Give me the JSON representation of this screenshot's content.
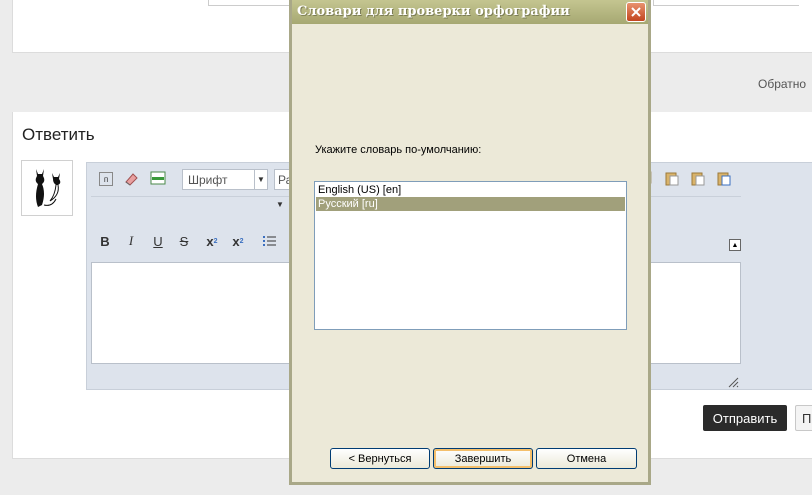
{
  "page": {
    "back_link": "Обратно",
    "reply_heading": "Ответить",
    "send_label": "Отправить",
    "preview_label": "П"
  },
  "editor": {
    "font_combo": "Шрифт",
    "size_combo": "Ра",
    "format_buttons": [
      "B",
      "I",
      "U",
      "S",
      "x",
      "x"
    ]
  },
  "dialog": {
    "title": "Словари для проверки орфографии",
    "label": "Укажите словарь по-умолчанию:",
    "dictionaries": [
      "English (US) [en]",
      "Русский [ru]"
    ],
    "selected_index": 1,
    "buttons": {
      "back": "< Вернуться",
      "finish": "Завершить",
      "cancel": "Отмена"
    }
  },
  "colors": {
    "dialog_bg": "#ece9d8",
    "titlebar": "#b4b57f",
    "selection": "#a1a07b",
    "send_button": "#2b2b2b"
  }
}
